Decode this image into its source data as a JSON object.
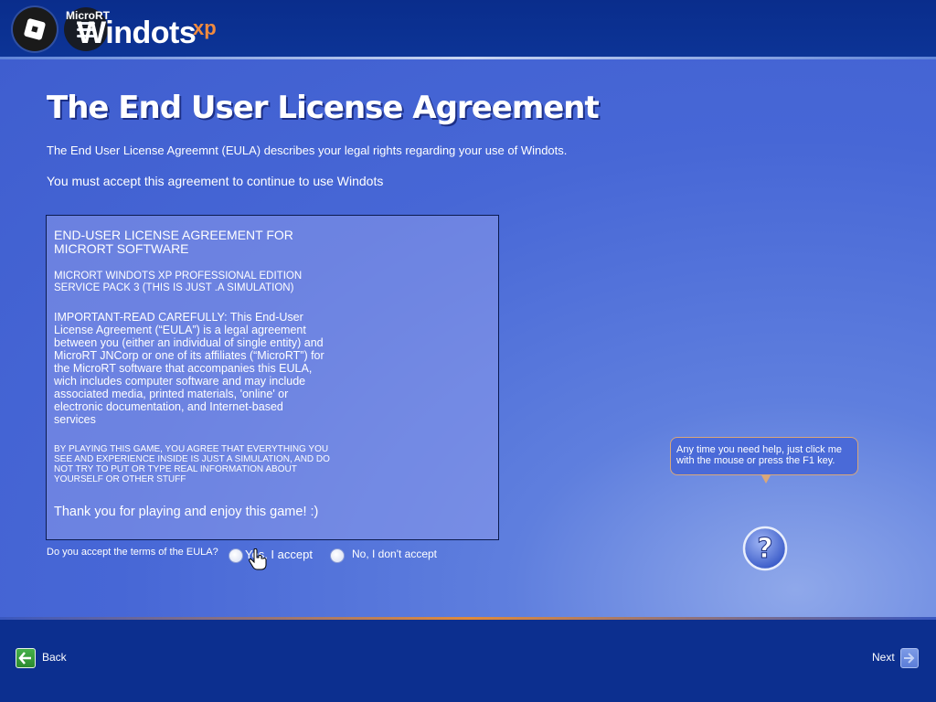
{
  "header": {
    "brand_small": "MicroRT",
    "brand_big": "Windots",
    "brand_super": "xp"
  },
  "main": {
    "title": "The End User License Agreement",
    "intro_line1": "The End User License Agreemnt (EULA) describes your legal rights regarding your use of Windots.",
    "intro_line2": "You must accept this agreement to continue to use Windots"
  },
  "eula": {
    "heading": "END-USER LICENSE AGREEMENT FOR MICRORT SOFTWARE",
    "product": "MICRORT WINDOTS XP PROFESSIONAL EDITION SERVICE PACK 3 (THIS IS JUST .A SIMULATION)",
    "important": "IMPORTANT-READ CAREFULLY: This End-User License Agreement (“EULA”) is a legal agreement between you (either an individual of single entity) and MicroRT JNCorp or one of its affiliates (“MicroRT”) for the MicroRT software that accompanies this EULA, wich includes computer software and may include associated media, printed materials, 'online' or electronic documentation, and Internet-based services",
    "small_print": "BY PLAYING THIS GAME, YOU AGREE THAT EVERYTHING YOU SEE AND EXPERIENCE INSIDE IS JUST A SIMULATION, AND DO NOT TRY TO PUT OR TYPE REAL INFORMATION ABOUT YOURSELF OR OTHER STUFF",
    "thanks": "Thank you for playing and enjoy this game! :)"
  },
  "accept": {
    "question": "Do you accept the terms of the EULA?",
    "yes_label": "Yes, I accept",
    "no_label": "No, I don't accept"
  },
  "help": {
    "tooltip": "Any time you need help, just click me with the mouse or press the F1 key."
  },
  "footer": {
    "back_label": "Back",
    "next_label": "Next"
  },
  "icons": {
    "roblox": "roblox-logo-icon",
    "menu": "hamburger-menu-icon",
    "back": "back-arrow-icon",
    "next": "next-arrow-icon",
    "help": "question-mark-icon",
    "cursor": "hand-pointer-icon"
  },
  "colors": {
    "header_bg": "#0c3496",
    "main_bg": "#4767d6",
    "brand_xp": "#f08a3e",
    "back_green": "#2b8a2e"
  }
}
